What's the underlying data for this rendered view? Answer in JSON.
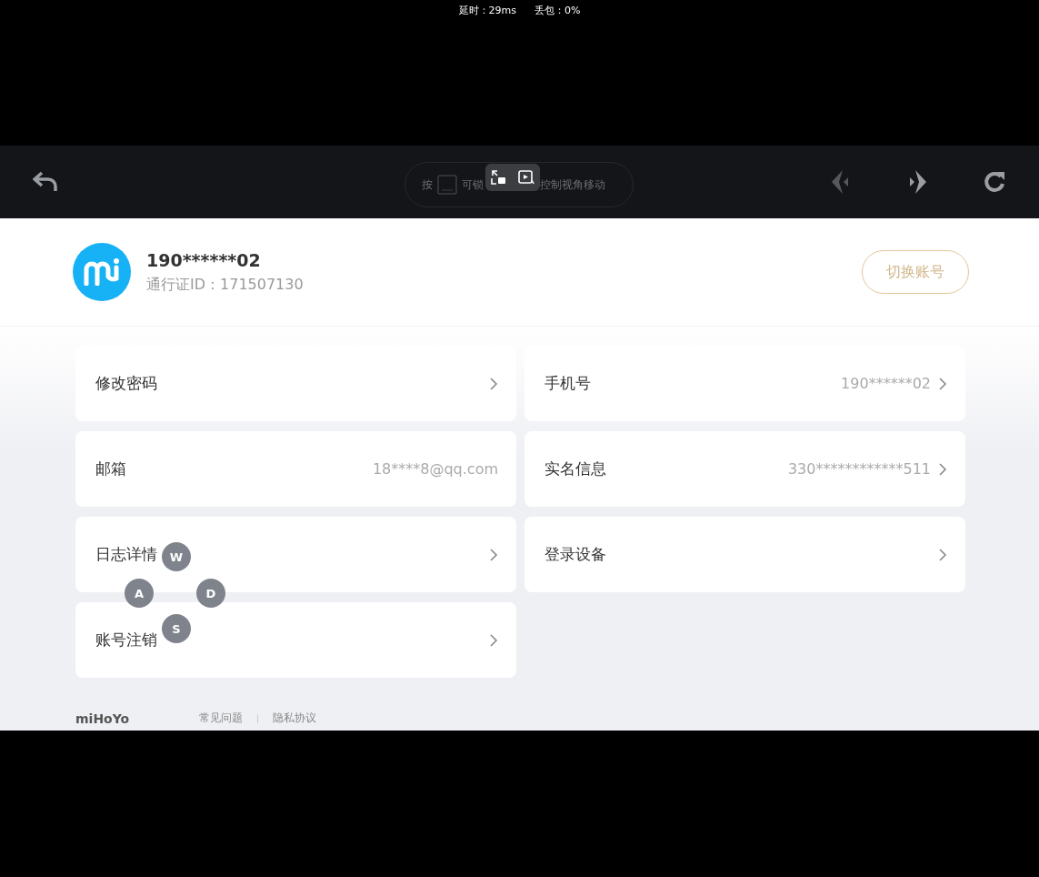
{
  "stream_stats": {
    "latency": "延时：29ms",
    "packet_loss": "丢包：0%"
  },
  "toolbar": {
    "hint_prefix": "按",
    "hint_middle": "可锁",
    "hint_suffix": "控制视角移动"
  },
  "profile": {
    "phone": "190******02",
    "pass_id": "通行证ID：171507130",
    "switch_button": "切换账号"
  },
  "settings": [
    {
      "label": "修改密码",
      "arrow": true
    },
    {
      "label": "手机号",
      "value": "190******02",
      "arrow": true
    },
    {
      "label": "邮箱",
      "value": "18****8@qq.com",
      "arrow": false
    },
    {
      "label": "实名信息",
      "value": "330************511",
      "arrow": true
    },
    {
      "label": "日志详情",
      "arrow": true
    },
    {
      "label": "登录设备",
      "arrow": true
    },
    {
      "label": "账号注销",
      "arrow": true
    }
  ],
  "footer": {
    "logo": "miHoYo",
    "links": [
      "常见问题",
      "隐私协议"
    ]
  },
  "wasd_keys": [
    "W",
    "A",
    "D",
    "S"
  ]
}
